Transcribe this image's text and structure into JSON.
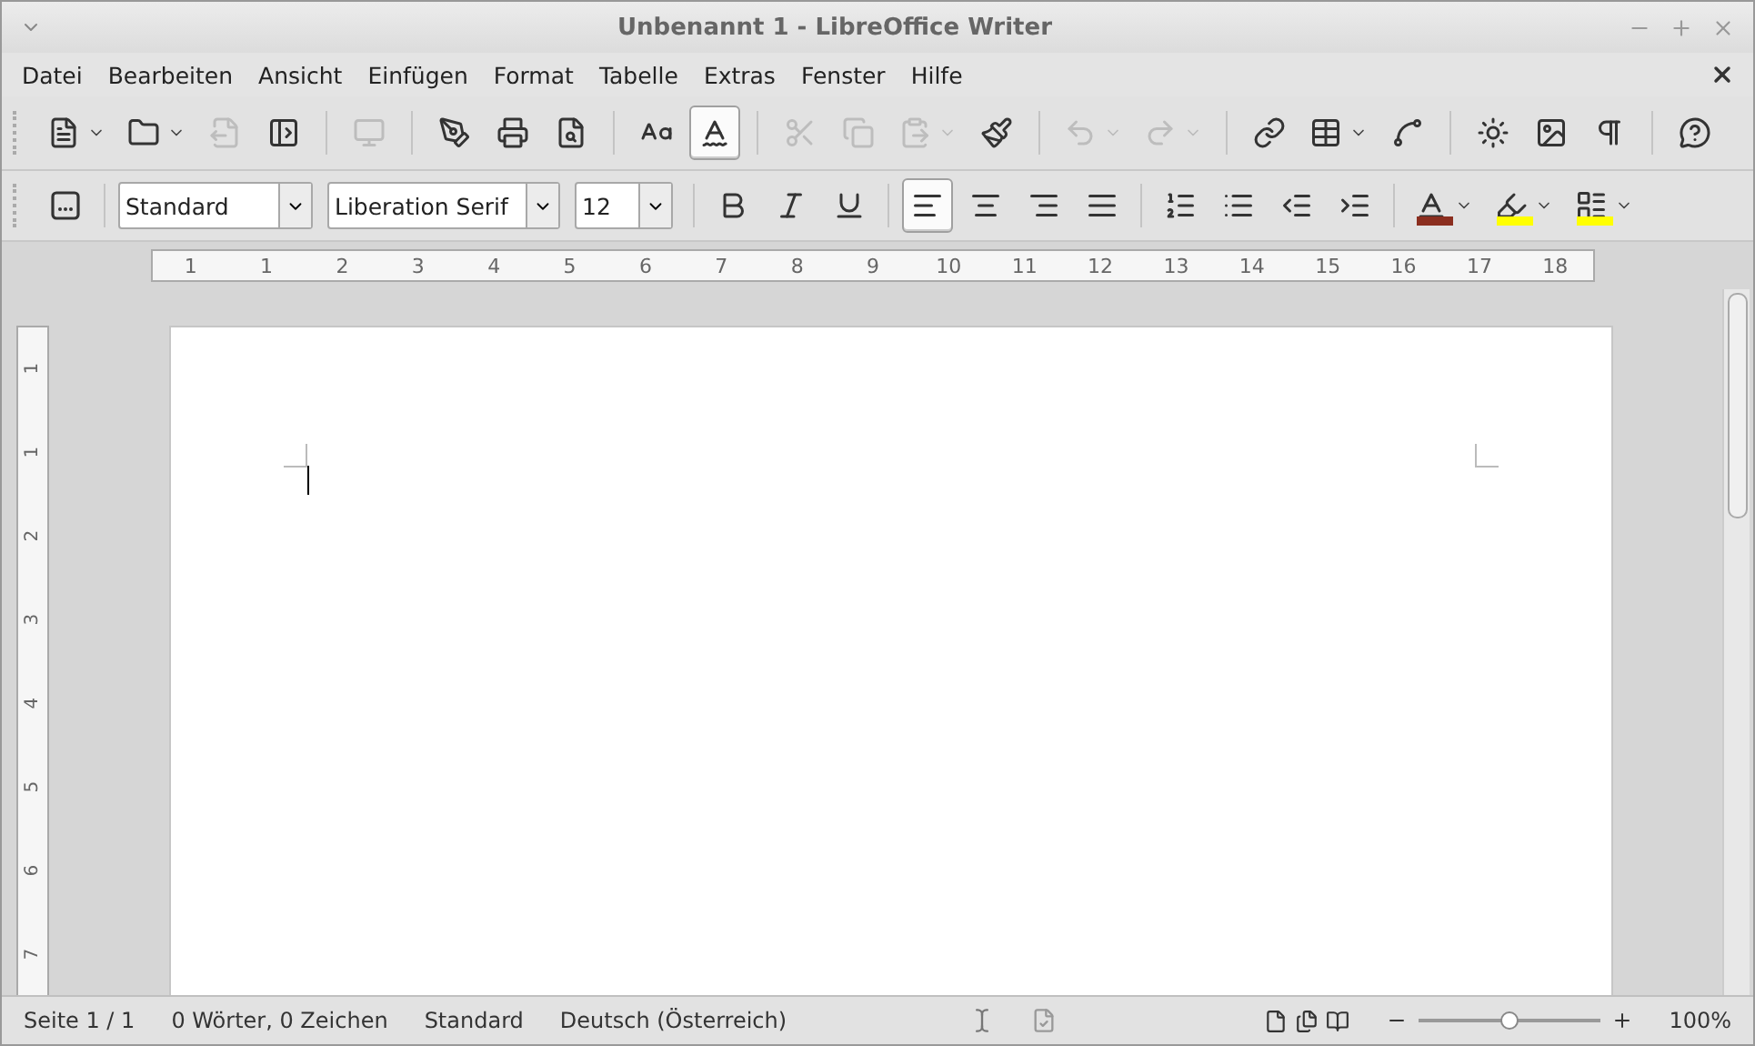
{
  "window": {
    "title": "Unbenannt 1 - LibreOffice Writer"
  },
  "menu": [
    "Datei",
    "Bearbeiten",
    "Ansicht",
    "Einfügen",
    "Format",
    "Tabelle",
    "Extras",
    "Fenster",
    "Hilfe"
  ],
  "toolbar_standard": [
    {
      "disabled": false,
      "pressed": false,
      "menu": true
    },
    {
      "disabled": false,
      "pressed": false,
      "menu": true
    },
    {
      "disabled": true,
      "pressed": false
    },
    {
      "disabled": false,
      "pressed": false
    },
    {
      "disabled": true,
      "pressed": false
    },
    {
      "disabled": false,
      "pressed": false
    },
    {
      "disabled": false,
      "pressed": false
    },
    {
      "disabled": false,
      "pressed": false
    },
    {
      "disabled": false
    },
    {
      "disabled": false,
      "pressed": true
    },
    {
      "disabled": true,
      "pressed": false
    },
    {
      "disabled": true,
      "pressed": false
    },
    {
      "disabled": true,
      "pressed": false,
      "menu": true
    },
    {
      "disabled": false,
      "pressed": false
    },
    {
      "disabled": true,
      "pressed": false,
      "menu": true
    },
    {
      "disabled": true,
      "pressed": false,
      "menu": true
    },
    {
      "disabled": false,
      "pressed": false
    },
    {
      "disabled": false,
      "pressed": false,
      "menu": true
    },
    {
      "disabled": false,
      "pressed": false
    },
    {
      "disabled": false,
      "pressed": false
    },
    {
      "disabled": false,
      "pressed": false
    },
    {
      "disabled": false,
      "pressed": false
    },
    {
      "disabled": false,
      "pressed": false
    }
  ],
  "formatting": {
    "style": "Standard",
    "font": "Liberation Serif",
    "size": "12",
    "buttons": [
      {
        "pressed": false
      },
      {
        "pressed": false
      },
      {
        "pressed": false
      },
      {
        "pressed": true
      },
      {
        "pressed": false
      },
      {
        "pressed": false
      },
      {
        "pressed": false
      },
      {
        "pressed": false
      },
      {
        "pressed": false
      },
      {
        "pressed": false
      },
      {
        "pressed": false
      },
      {
        "pressed": false,
        "menu": true,
        "color": "#8b2e1f"
      },
      {
        "pressed": false,
        "menu": true,
        "color": "#ffff00"
      },
      {
        "pressed": false,
        "menu": true,
        "color": "#ffff00"
      }
    ]
  },
  "ruler": {
    "labels": [
      "1",
      "1",
      "2",
      "3",
      "4",
      "5",
      "6",
      "7",
      "8",
      "9",
      "10",
      "11",
      "12",
      "13",
      "14",
      "15",
      "16",
      "17",
      "18"
    ]
  },
  "vertical_ruler": {
    "labels": [
      "1",
      "1",
      "2",
      "3",
      "4",
      "5",
      "6",
      "7"
    ]
  },
  "status_bar": {
    "page": "Seite 1 / 1",
    "words": "0 Wörter, 0 Zeichen",
    "style": "Standard",
    "language": "Deutsch (Österreich)",
    "zoom": "100%",
    "zoom_slider": {
      "level": 0.5
    }
  }
}
